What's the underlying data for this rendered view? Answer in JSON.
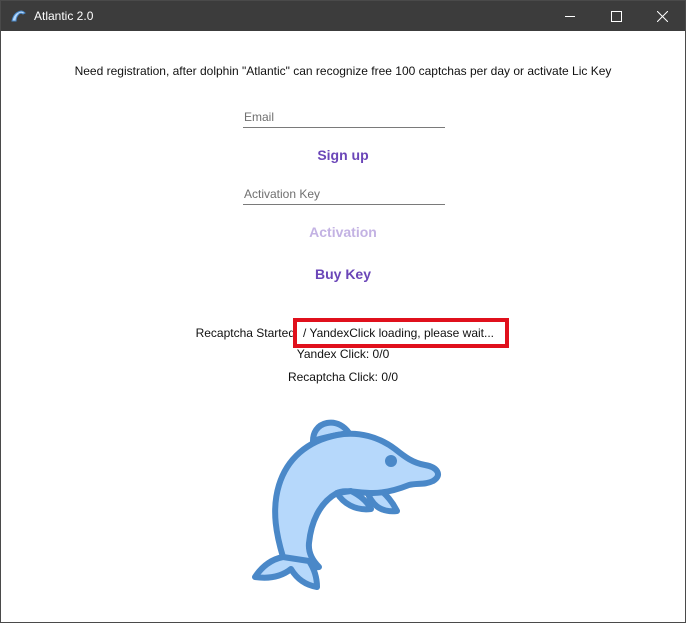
{
  "window": {
    "title": "Atlantic 2.0"
  },
  "info_text": "Need registration, after dolphin \"Atlantic\" can recognize free 100 captchas per day or activate Lic Key",
  "email": {
    "placeholder": "Email",
    "value": ""
  },
  "signup_label": "Sign up",
  "activation_key": {
    "placeholder": "Activation Key",
    "value": ""
  },
  "activation_label": "Activation",
  "buy_key_label": "Buy Key",
  "status": {
    "label": "Recaptcha Started",
    "message": "/ YandexClick loading, please wait..."
  },
  "counters": {
    "yandex": "Yandex Click: 0/0",
    "recaptcha": "Recaptcha Click: 0/0"
  },
  "colors": {
    "accent": "#6b46b8",
    "accent_disabled": "#c3b2e3",
    "highlight_border": "#e0101c",
    "dolphin_fill": "#b6d8fb",
    "dolphin_stroke": "#4a88c8"
  },
  "icons": [
    "dolphin-icon",
    "minimize-icon",
    "maximize-icon",
    "close-icon"
  ]
}
